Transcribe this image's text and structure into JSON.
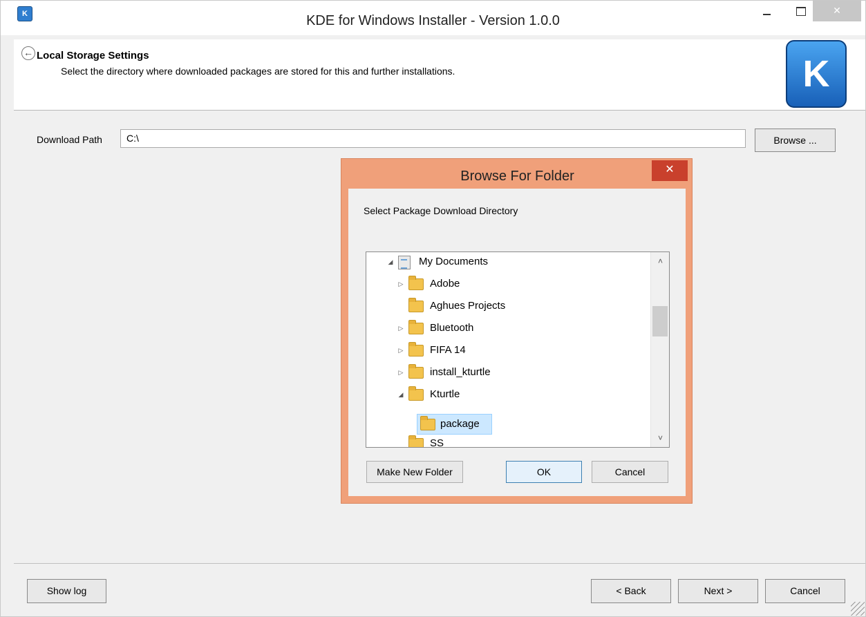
{
  "window": {
    "title": "KDE for Windows Installer - Version 1.0.0",
    "icon": "kde-app-icon",
    "close_glyph": "✕"
  },
  "header": {
    "back_glyph": "←",
    "title": "Local Storage Settings",
    "subtitle": "Select the directory where downloaded packages are stored for this and further installations.",
    "logo_glyph": "K"
  },
  "download": {
    "label": "Download Path",
    "value": "C:\\",
    "browse_label": "Browse ..."
  },
  "dialog": {
    "title": "Browse For Folder",
    "close_glyph": "✕",
    "prompt": "Select Package Download Directory",
    "tree": [
      {
        "label": "My Documents",
        "expander": "◢",
        "icon": "documents-library-icon"
      },
      {
        "label": "Adobe",
        "expander": "▷",
        "icon": "folder-icon"
      },
      {
        "label": "Aghues Projects",
        "expander": "",
        "icon": "folder-icon"
      },
      {
        "label": "Bluetooth",
        "expander": "▷",
        "icon": "folder-icon"
      },
      {
        "label": "FIFA 14",
        "expander": "▷",
        "icon": "folder-icon"
      },
      {
        "label": "install_kturtle",
        "expander": "▷",
        "icon": "folder-icon"
      },
      {
        "label": "Kturtle",
        "expander": "◢",
        "icon": "folder-icon"
      },
      {
        "label": "package",
        "expander": "",
        "icon": "folder-icon",
        "selected": true
      },
      {
        "label": "SS",
        "expander": "",
        "icon": "folder-icon"
      }
    ],
    "scroll_up": "˄",
    "scroll_down": "˅",
    "buttons": {
      "new_folder": "Make New Folder",
      "ok": "OK",
      "cancel": "Cancel"
    }
  },
  "footer": {
    "show_log": "Show log",
    "back": "< Back",
    "next": "Next >",
    "cancel": "Cancel"
  },
  "colors": {
    "dialog_frame": "#f0a07a",
    "dialog_close": "#c9402c",
    "selection": "#cce8ff",
    "folder": "#f3c34d"
  }
}
